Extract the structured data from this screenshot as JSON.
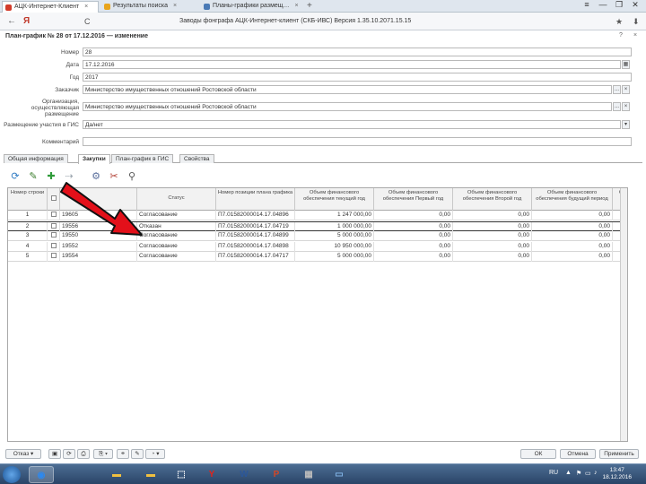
{
  "browser": {
    "tabs": [
      {
        "label": "АЦК-Интернет-Клиент",
        "color": "#d23b2a"
      },
      {
        "label": "Результаты поиска",
        "color": "#e8a41c"
      },
      {
        "label": "Планы-графики размещ…",
        "color": "#4a7ab5"
      }
    ],
    "tab_close": "×",
    "new_tab": "+",
    "window_controls": [
      "≡",
      "—",
      "❐",
      "✕"
    ],
    "back": "←",
    "address_text": "Заводы фонграфа  АЦК-Интернет-клиент (СКБ-ИВС)  Версия 1.35.10.2071.15.15",
    "addr_icon_left": "Я",
    "addr_icon_reload": "С",
    "addr_icon_right": [
      "★",
      "⬇"
    ]
  },
  "form": {
    "title": "План-график № 28 от 17.12.2016 — изменение",
    "header_buttons": [
      "?",
      "×"
    ],
    "fields": [
      {
        "label": "Номер",
        "value": "28"
      },
      {
        "label": "Дата",
        "value": "17.12.2016"
      },
      {
        "label": "Год",
        "value": "2017"
      },
      {
        "label": "Заказчик",
        "value": "Министерство имущественных отношений Ростовской области"
      },
      {
        "label": "Организация, осуществляющая размещение",
        "value": "Министерство имущественных отношений Ростовской области"
      },
      {
        "label": "Размещение участия в ГИС",
        "value": "Да/нет"
      },
      {
        "label": "Комментарий",
        "value": ""
      }
    ],
    "field_button": "...",
    "date_button": "▦",
    "select_button": "▾",
    "tabs": [
      "Общая информация",
      "Закупки",
      "План-график в ГИС",
      "Свойства"
    ],
    "active_tab": 1
  },
  "toolbar": {
    "icons": [
      "refresh-icon",
      "edit-icon",
      "add-icon",
      "move-icon",
      "settings-icon",
      "tools-icon",
      "filter-icon"
    ],
    "glyphs": [
      "⟳",
      "✎",
      "✚",
      "⇢",
      "⚙",
      "✂",
      "⚲"
    ]
  },
  "grid": {
    "columns": [
      "Номер строки",
      "",
      "",
      "Статус",
      "Номер позиции плана графика",
      "Объем финансового обеспечения текущий год",
      "Объем финансового обеспечения Первый год",
      "Объем финансового обеспечения Второй год",
      "Объем финансового обеспечения будущий период",
      "Объ"
    ],
    "rows": [
      {
        "n": "1",
        "id": "19605",
        "status": "Согласование",
        "pos": "П7.01582000014.17.04896",
        "v0": "1 247 000,00",
        "v1": "0,00",
        "v2": "0,00",
        "v3": "0,00"
      },
      {
        "n": "2",
        "id": "19556",
        "status": "Отказан",
        "pos": "П7.01582000014.17.04719",
        "v0": "1 000 000,00",
        "v1": "0,00",
        "v2": "0,00",
        "v3": "0,00"
      },
      {
        "n": "3",
        "id": "19550",
        "status": "Согласование",
        "pos": "П7.01582000014.17.04899",
        "v0": "5 000 000,00",
        "v1": "0,00",
        "v2": "0,00",
        "v3": "0,00"
      },
      {
        "n": "4",
        "id": "19552",
        "status": "Согласование",
        "pos": "П7.01582000014.17.04898",
        "v0": "10 950 000,00",
        "v1": "0,00",
        "v2": "0,00",
        "v3": "0,00"
      },
      {
        "n": "5",
        "id": "19554",
        "status": "Согласование",
        "pos": "П7.01582000014.17.04717",
        "v0": "5 000 000,00",
        "v1": "0,00",
        "v2": "0,00",
        "v3": "0,00"
      }
    ]
  },
  "bottom": {
    "left_buttons": [
      "Отказ ▾",
      "▣",
      "⟳",
      "⎙",
      "⎘ ▾",
      "⚭",
      "✎",
      "◔ ▾"
    ],
    "right_buttons": [
      "ОК",
      "Отмена",
      "Применить"
    ]
  },
  "taskbar": {
    "apps": [
      {
        "glyph": "◉",
        "color": "#2d89ef"
      },
      {
        "glyph": "▬",
        "color": "#f0c040"
      },
      {
        "glyph": "▬",
        "color": "#f0c040"
      },
      {
        "glyph": "⬚",
        "color": "#ffffff"
      },
      {
        "glyph": "Y",
        "color": "#e2231a"
      },
      {
        "glyph": "W",
        "color": "#2b579a"
      },
      {
        "glyph": "P",
        "color": "#d24726"
      },
      {
        "glyph": "▦",
        "color": "#bbbbbb"
      },
      {
        "glyph": "▭",
        "color": "#7fb2e5"
      }
    ],
    "tray": [
      "RU",
      "▲",
      "⚑",
      "▭",
      "♪"
    ],
    "time": "13:47",
    "date": "18.12.2016"
  }
}
